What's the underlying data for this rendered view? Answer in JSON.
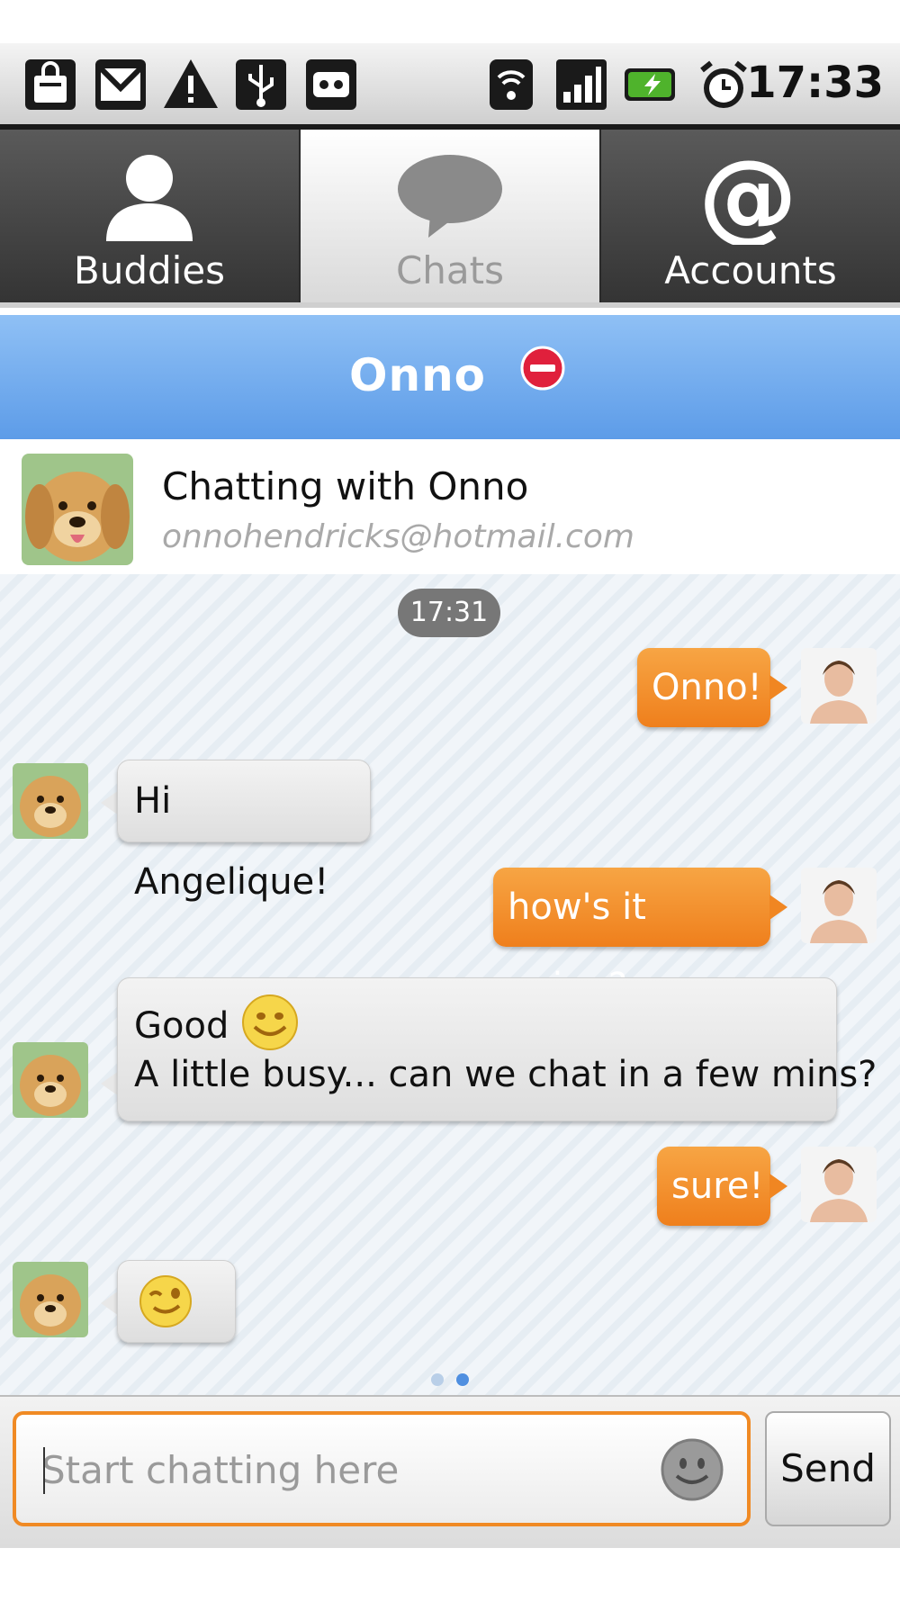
{
  "status_bar": {
    "time": "17:33",
    "icons": [
      "shopping-bag-icon",
      "gmail-icon",
      "warning-icon",
      "usb-icon",
      "voicemail-icon",
      "wifi-icon",
      "signal-icon",
      "battery-charging-icon",
      "alarm-icon"
    ]
  },
  "tabs": [
    {
      "label": "Buddies",
      "icon": "person-icon",
      "active": false
    },
    {
      "label": "Chats",
      "icon": "speech-bubble-icon",
      "active": true
    },
    {
      "label": "Accounts",
      "icon": "at-sign-icon",
      "active": false
    }
  ],
  "header": {
    "name": "Onno",
    "status": "busy"
  },
  "contact": {
    "title": "Chatting with Onno",
    "email": "onnohendricks@hotmail.com"
  },
  "conversation": {
    "timestamp": "17:31",
    "messages": [
      {
        "from": "me",
        "text": "Onno!"
      },
      {
        "from": "them",
        "text": "Hi Angelique!"
      },
      {
        "from": "me",
        "text": "how's it going?"
      },
      {
        "from": "them",
        "line1": "Good",
        "line2": "A little busy... can we chat in a few mins?",
        "emoji": "smile"
      },
      {
        "from": "me",
        "text": "sure!"
      },
      {
        "from": "them",
        "emoji": "wink"
      }
    ]
  },
  "composer": {
    "placeholder": "Start chatting here",
    "send_label": "Send"
  },
  "colors": {
    "header_blue": "#5d9ce8",
    "outgoing_orange": "#ef7f1c",
    "busy_red": "#e0203c"
  }
}
